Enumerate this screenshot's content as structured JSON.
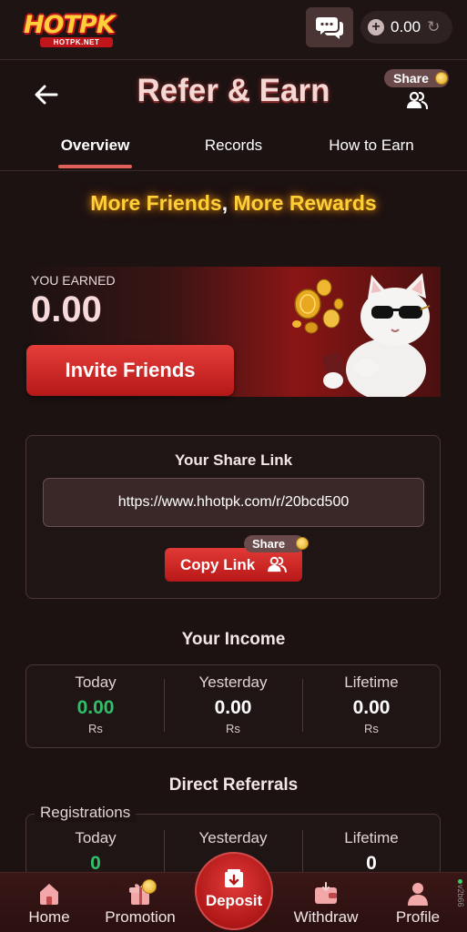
{
  "topbar": {
    "logo_text": "HOTPK",
    "logo_subtext": "HOTPK.NET",
    "balance": "0.00"
  },
  "header": {
    "title": "Refer & Earn",
    "share_label": "Share"
  },
  "tabs": [
    {
      "label": "Overview",
      "active": true
    },
    {
      "label": "Records",
      "active": false
    },
    {
      "label": "How to Earn",
      "active": false
    }
  ],
  "headline": {
    "part1": "More Friends",
    "sep": ",",
    "part2": "More Rewards"
  },
  "earned": {
    "label": "YOU EARNED",
    "value": "0.00",
    "invite_label": "Invite Friends"
  },
  "share_link": {
    "title": "Your Share Link",
    "url": "https://www.hhotpk.com/r/20bcd500",
    "copy_label": "Copy Link",
    "share_label": "Share"
  },
  "income": {
    "title": "Your Income",
    "stats": [
      {
        "label": "Today",
        "value": "0.00",
        "unit": "Rs"
      },
      {
        "label": "Yesterday",
        "value": "0.00",
        "unit": "Rs"
      },
      {
        "label": "Lifetime",
        "value": "0.00",
        "unit": "Rs"
      }
    ]
  },
  "referrals": {
    "title": "Direct Referrals",
    "section_label": "Registrations",
    "stats": [
      {
        "label": "Today",
        "value": "0"
      },
      {
        "label": "Yesterday",
        "value": ""
      },
      {
        "label": "Lifetime",
        "value": "0"
      }
    ]
  },
  "bottom_nav": [
    {
      "label": "Home",
      "icon": "home-icon"
    },
    {
      "label": "Promotion",
      "icon": "gift-icon"
    },
    {
      "label": "Deposit",
      "icon": "deposit-icon"
    },
    {
      "label": "Withdraw",
      "icon": "wallet-icon"
    },
    {
      "label": "Profile",
      "icon": "user-icon"
    }
  ],
  "version_text": "v2b66",
  "colors": {
    "background": "#1c1212",
    "accent_red": "#c62222",
    "gold": "#ffcf3a",
    "green": "#2fc06a"
  }
}
